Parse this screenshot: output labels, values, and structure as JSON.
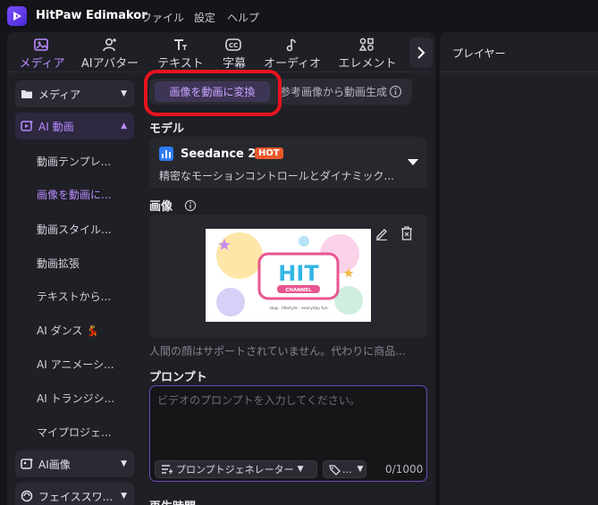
{
  "app": {
    "title": "HitPaw Edimakor"
  },
  "menu": [
    "ファイル",
    "設定",
    "ヘルプ"
  ],
  "toolbar": {
    "tabs": [
      {
        "label": "メディア",
        "icon": "media-icon"
      },
      {
        "label": "AIアバター",
        "icon": "ai-avatar-icon"
      },
      {
        "label": "テキスト",
        "icon": "text-icon"
      },
      {
        "label": "字幕",
        "icon": "subtitle-icon"
      },
      {
        "label": "オーディオ",
        "icon": "audio-icon"
      },
      {
        "label": "エレメント",
        "icon": "element-icon"
      }
    ],
    "active": "メディア"
  },
  "sidebar": {
    "media": "メディア",
    "ai_video": "AI 動画",
    "sub_items": [
      "動画テンプレ...",
      "画像を動画に...",
      "動画スタイル...",
      "動画拡張",
      "テキストから...",
      "AI ダンス",
      "AI アニメーシ...",
      "AI トランジシ...",
      "マイプロジェ..."
    ],
    "ai_image": "AI画像",
    "face_swap": "フェイススワ..."
  },
  "main": {
    "seg_active": "画像を動画に変換",
    "seg_other": "参考画像から動画生成",
    "model_label": "モデル",
    "model_name": "Seedance 2.0",
    "model_badge": "HOT",
    "model_desc": "精密なモーションコントロールとダイナミック...",
    "image_label": "画像",
    "thumb_logo": "HIT",
    "thumb_sub": "CHANNEL",
    "thumb_caption": "vlog · lifestyle · everyday fun",
    "notice": "人間の顔はサポートされていません。代わりに商品...",
    "prompt_label": "プロンプト",
    "prompt_placeholder": "ビデオのプロンプトを入力してください。",
    "prompt_generator": "プロンプトジェネレーター",
    "style_btn": "...",
    "char_count": "0/1000",
    "cut_label": "再生時間"
  },
  "player": {
    "title": "プレイヤー"
  },
  "colors": {
    "accent": "#b98cff",
    "highlight": "#e8131f",
    "hot": "#e85a2a"
  }
}
